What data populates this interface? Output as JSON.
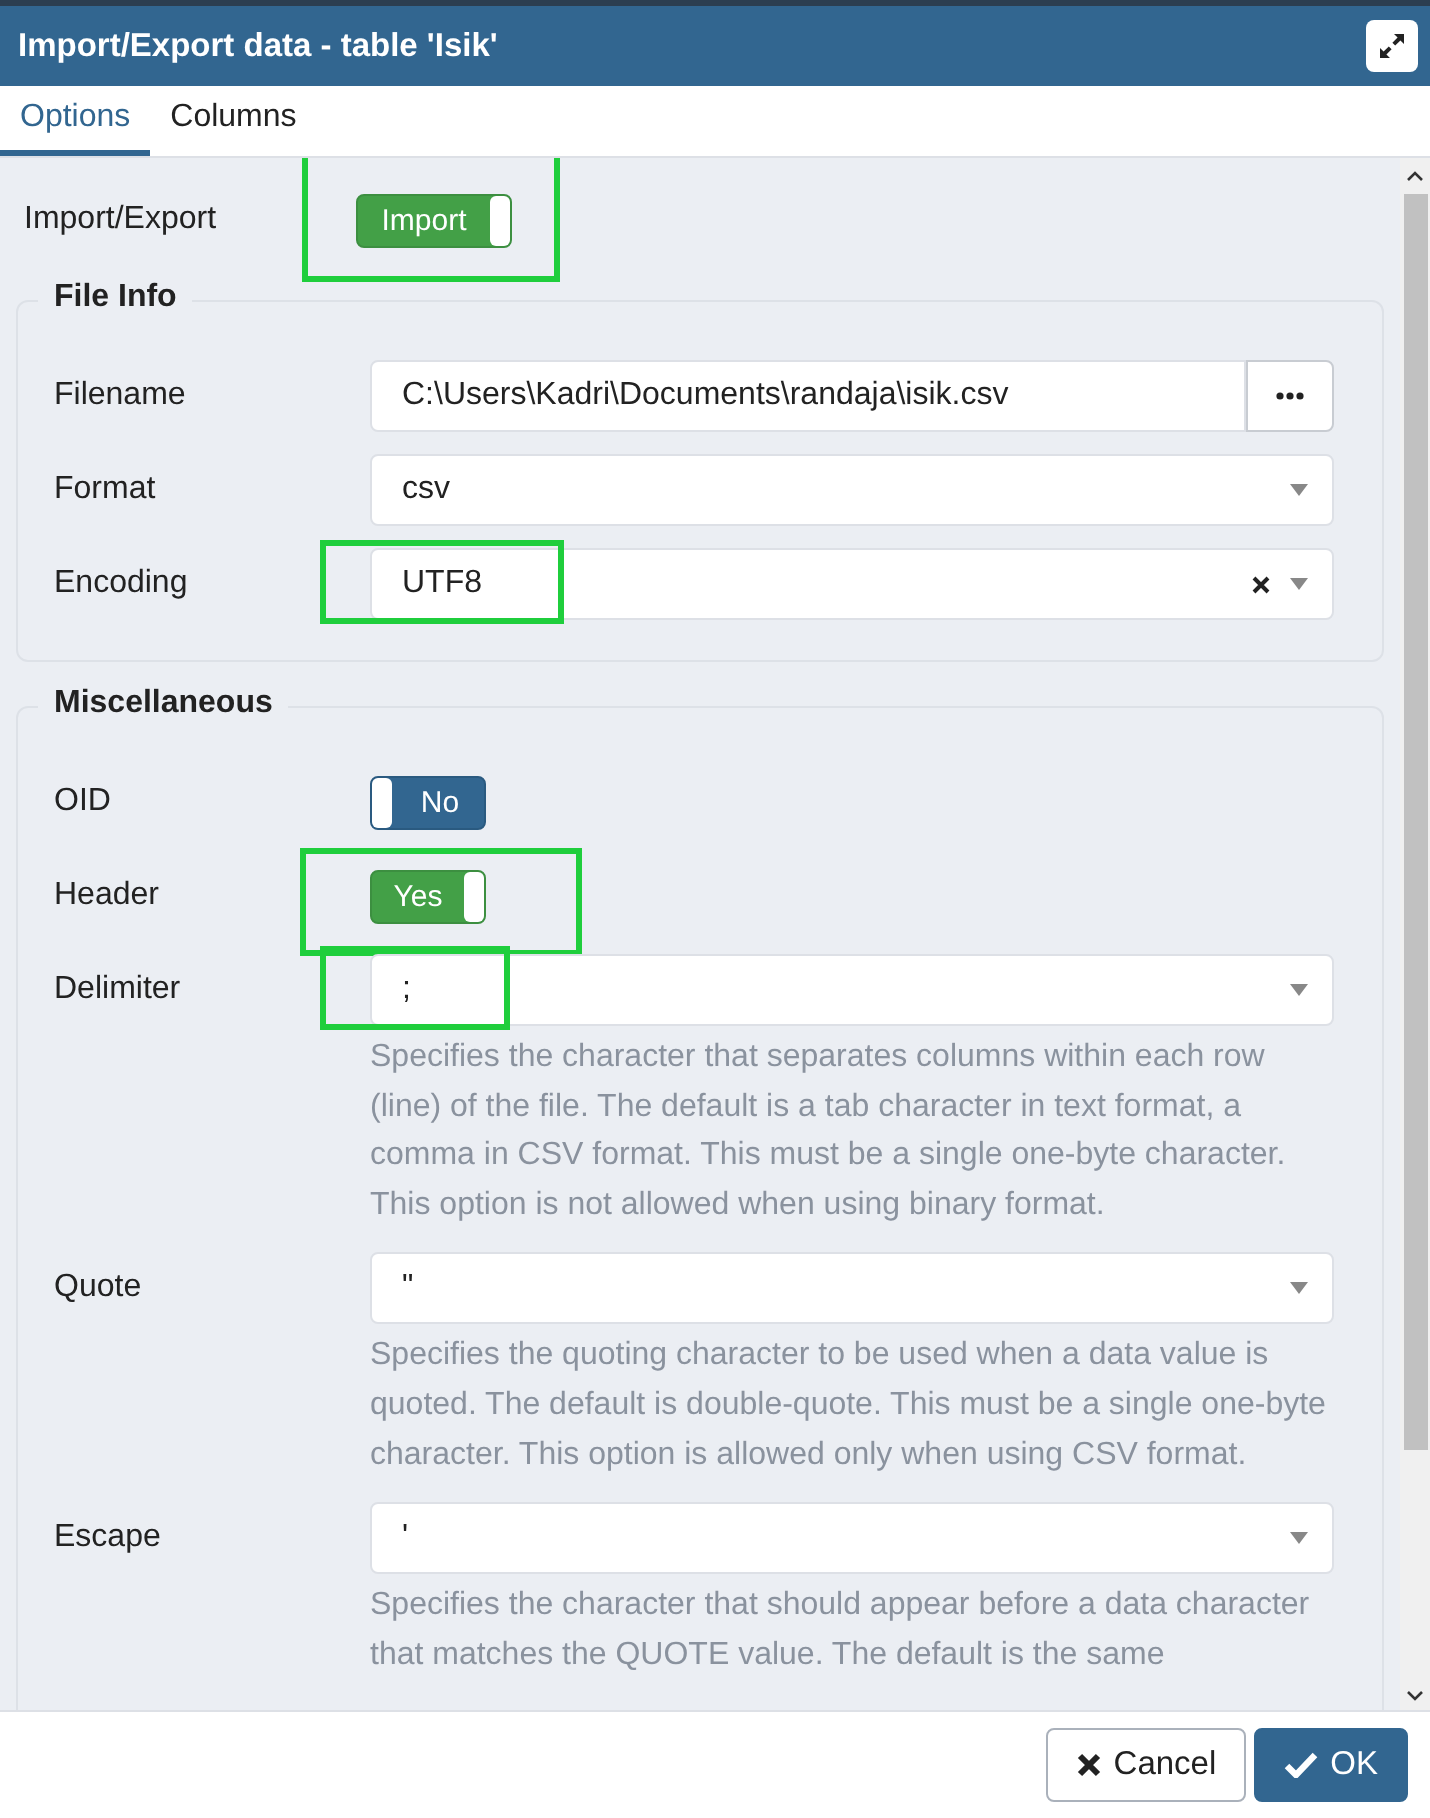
{
  "dialog": {
    "title": "Import/Export data - table 'Isik'"
  },
  "tabs": [
    {
      "label": "Options",
      "selected": true
    },
    {
      "label": "Columns",
      "selected": false
    }
  ],
  "import_export": {
    "label": "Import/Export",
    "text": "Import",
    "on": true,
    "highlighted": true
  },
  "sections": [
    {
      "title": "File Info",
      "rows": [
        {
          "kind": "file",
          "label": "Filename",
          "value": "C:\\Users\\Kadri\\Documents\\randaja\\isik.csv"
        },
        {
          "kind": "select",
          "label": "Format",
          "value": "csv"
        },
        {
          "kind": "select",
          "label": "Encoding",
          "value": "UTF8",
          "clearable": true,
          "highlighted": true
        }
      ]
    },
    {
      "title": "Miscellaneous",
      "rows": [
        {
          "kind": "toggle",
          "label": "OID",
          "text": "No",
          "on": false
        },
        {
          "kind": "toggle",
          "label": "Header",
          "text": "Yes",
          "on": true,
          "highlighted": true
        },
        {
          "kind": "select",
          "label": "Delimiter",
          "value": ";",
          "highlighted": true,
          "help": "Specifies the character that separates columns within each row (line) of the file. The default is a tab character in text format, a comma in CSV format. This must be a single one-byte character. This option is not allowed when using binary format."
        },
        {
          "kind": "select",
          "label": "Quote",
          "value": "\"",
          "help": "Specifies the quoting character to be used when a data value is quoted. The default is double-quote. This must be a single one-byte character. This option is allowed only when using CSV format."
        },
        {
          "kind": "select",
          "label": "Escape",
          "value": "'",
          "help": "Specifies the character that should appear before a data character that matches the QUOTE value. The default is the same"
        }
      ]
    }
  ],
  "buttons": [
    {
      "kind": "cancel",
      "label": "Cancel"
    },
    {
      "kind": "ok",
      "label": "OK"
    }
  ]
}
